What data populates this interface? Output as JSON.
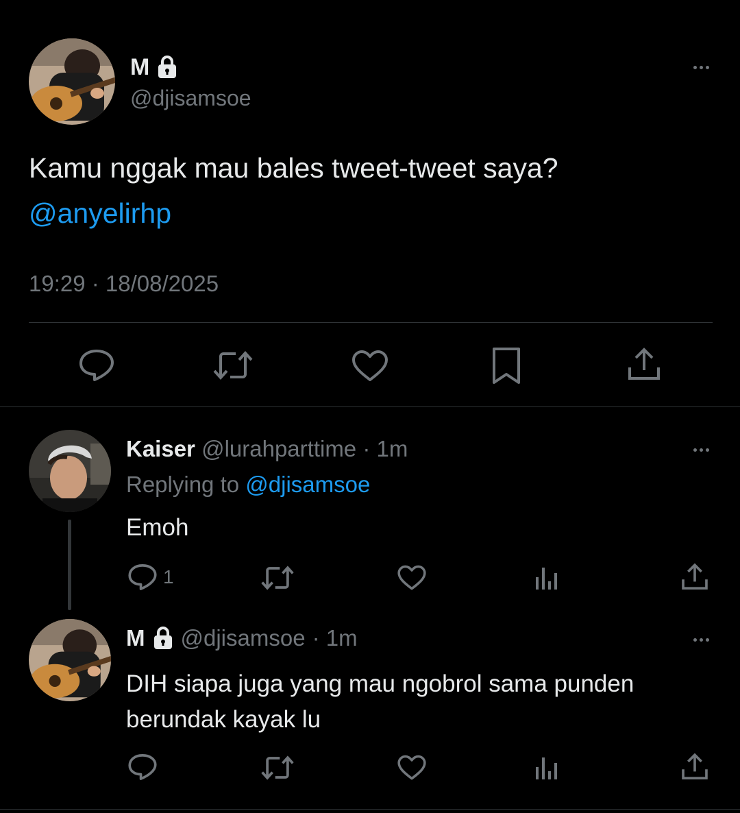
{
  "main_tweet": {
    "display_name": "M",
    "handle": "@djisamsoe",
    "text": "Kamu nggak mau bales tweet-tweet saya?",
    "mention": "@anyelirhp",
    "timestamp": "19:29 · 18/08/2025",
    "actions": [
      "reply-icon",
      "retweet-icon",
      "like-icon",
      "bookmark-icon",
      "share-icon"
    ]
  },
  "reply_1": {
    "display_name": "Kaiser",
    "handle": "@lurahparttime",
    "time": "· 1m",
    "replying_prefix": "Replying to",
    "replying_handle": "@djisamsoe",
    "text": "Emoh",
    "reply_count": "1"
  },
  "reply_2": {
    "display_name": "M",
    "handle": "@djisamsoe",
    "time": "· 1m",
    "text_line1": "DIH siapa juga yang mau ngobrol sama punden",
    "text_line2": "berundak kayak lu"
  },
  "colors": {
    "background": "#000000",
    "text": "#e7e9ea",
    "muted": "#71767b",
    "link": "#1d9bf0",
    "divider": "#2f3336"
  }
}
